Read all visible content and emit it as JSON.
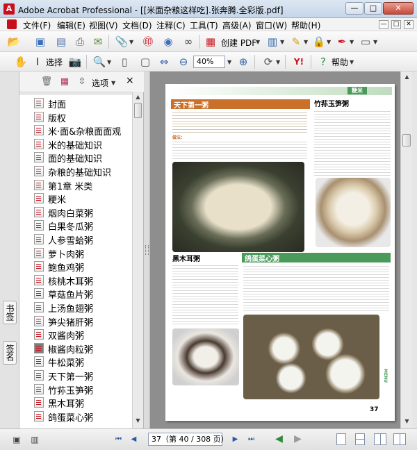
{
  "window": {
    "title": "Adobe Acrobat Professional - [[米面杂粮这样吃].张奔腾.全彩版.pdf]",
    "minimize": "—",
    "maximize": "□",
    "close": "✕"
  },
  "menu": {
    "items": [
      "文件(F)",
      "编辑(E)",
      "视图(V)",
      "文档(D)",
      "注释(C)",
      "工具(T)",
      "高级(A)",
      "窗口(W)",
      "帮助(H)"
    ],
    "mdi_min": "—",
    "mdi_restore": "□",
    "mdi_close": "✕"
  },
  "toolbar1": {
    "create_pdf": "创建 PDF"
  },
  "toolbar2": {
    "select": "选择",
    "zoom": "40%",
    "help": "帮助"
  },
  "left_panel": {
    "tab_bookmarks": "书签",
    "tab_signatures": "签名",
    "options": "选项",
    "close": "×",
    "bookmarks": [
      "封面",
      "版权",
      "米·面&杂粮面面观",
      "米的基础知识",
      "面的基础知识",
      "杂粮的基础知识",
      "第1章  米类",
      "粳米",
      "烟肉白菜粥",
      "白果冬瓜粥",
      "人参雪蛤粥",
      "萝卜肉粥",
      "鲍鱼鸡粥",
      "核桃木耳粥",
      "草菇鱼片粥",
      "上汤鱼翅粥",
      "笋尖猪肝粥",
      "双酱肉粥",
      "椒酱肉粒粥",
      "牛松菜粥",
      "天下第一粥",
      "竹荪玉笋粥",
      "黑木耳粥",
      "鸽蛋菜心粥"
    ]
  },
  "page": {
    "section_tag": "粳米",
    "dish1": "天下第一粥",
    "dish2": "竹荪玉笋粥",
    "dish3": "黑木耳粥",
    "dish4": "鸽蛋菜心粥",
    "sub_method": "做法：",
    "side_label": "MENU",
    "page_number": "37"
  },
  "statusbar": {
    "page_indicator": "37（第 40 / 308 页）"
  },
  "colors": {
    "accent_red": "#c8101a",
    "page_brown": "#c9702b",
    "page_green": "#4a9a5a",
    "doc_bg": "#8e8e8e"
  }
}
